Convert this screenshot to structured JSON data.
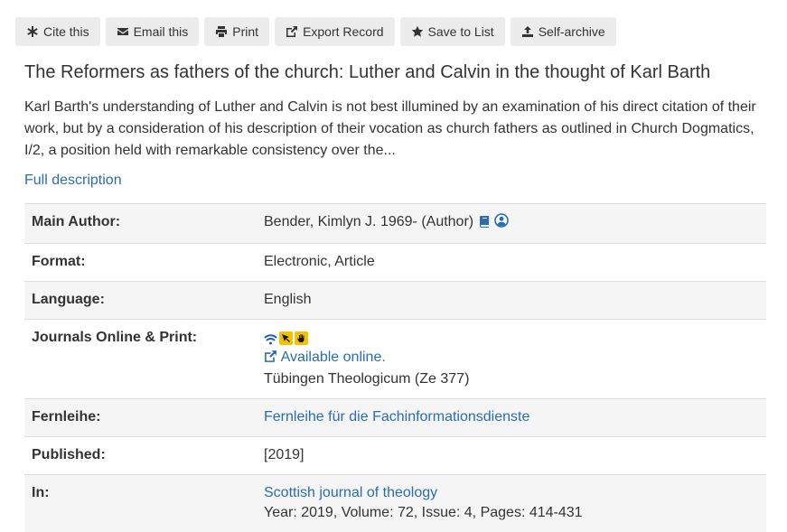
{
  "toolbar": {
    "cite": "Cite this",
    "email": "Email this",
    "print": "Print",
    "export": "Export Record",
    "save": "Save to List",
    "archive": "Self-archive"
  },
  "record": {
    "title": "The Reformers as fathers of the church: Luther and Calvin in the thought of Karl Barth",
    "abstract": "Karl Barth's understanding of Luther and Calvin is not best illumined by an examination of his direct citation of their work, but by a consideration of his description of their vocation as church fathers as outlined in Church Dogmatics, I/2, a position held with remarkable consistency over the...",
    "full_description": "Full description"
  },
  "details": {
    "main_author_label": "Main Author:",
    "main_author": "Bender, Kimlyn J. 1969- (Author)",
    "format_label": "Format:",
    "format": "Electronic, Article",
    "language_label": "Language:",
    "language": "English",
    "journals_label": "Journals Online & Print:",
    "available_online": "Available online.",
    "holding": "Tübingen Theologicum (Ze 377)",
    "fernleihe_label": "Fernleihe:",
    "fernleihe": "Fernleihe für die Fachinformationsdienste",
    "published_label": "Published:",
    "published": "[2019]",
    "in_label": "In:",
    "in_journal": "Scottish journal of theology",
    "in_details": "Year: 2019, Volume: 72, Issue: 4, Pages: 414-431"
  },
  "colors": {
    "link": "#2a6db0",
    "button_bg": "#ececec",
    "row_alt": "#f5f5f5",
    "badge_yellow": "#f2c200"
  }
}
